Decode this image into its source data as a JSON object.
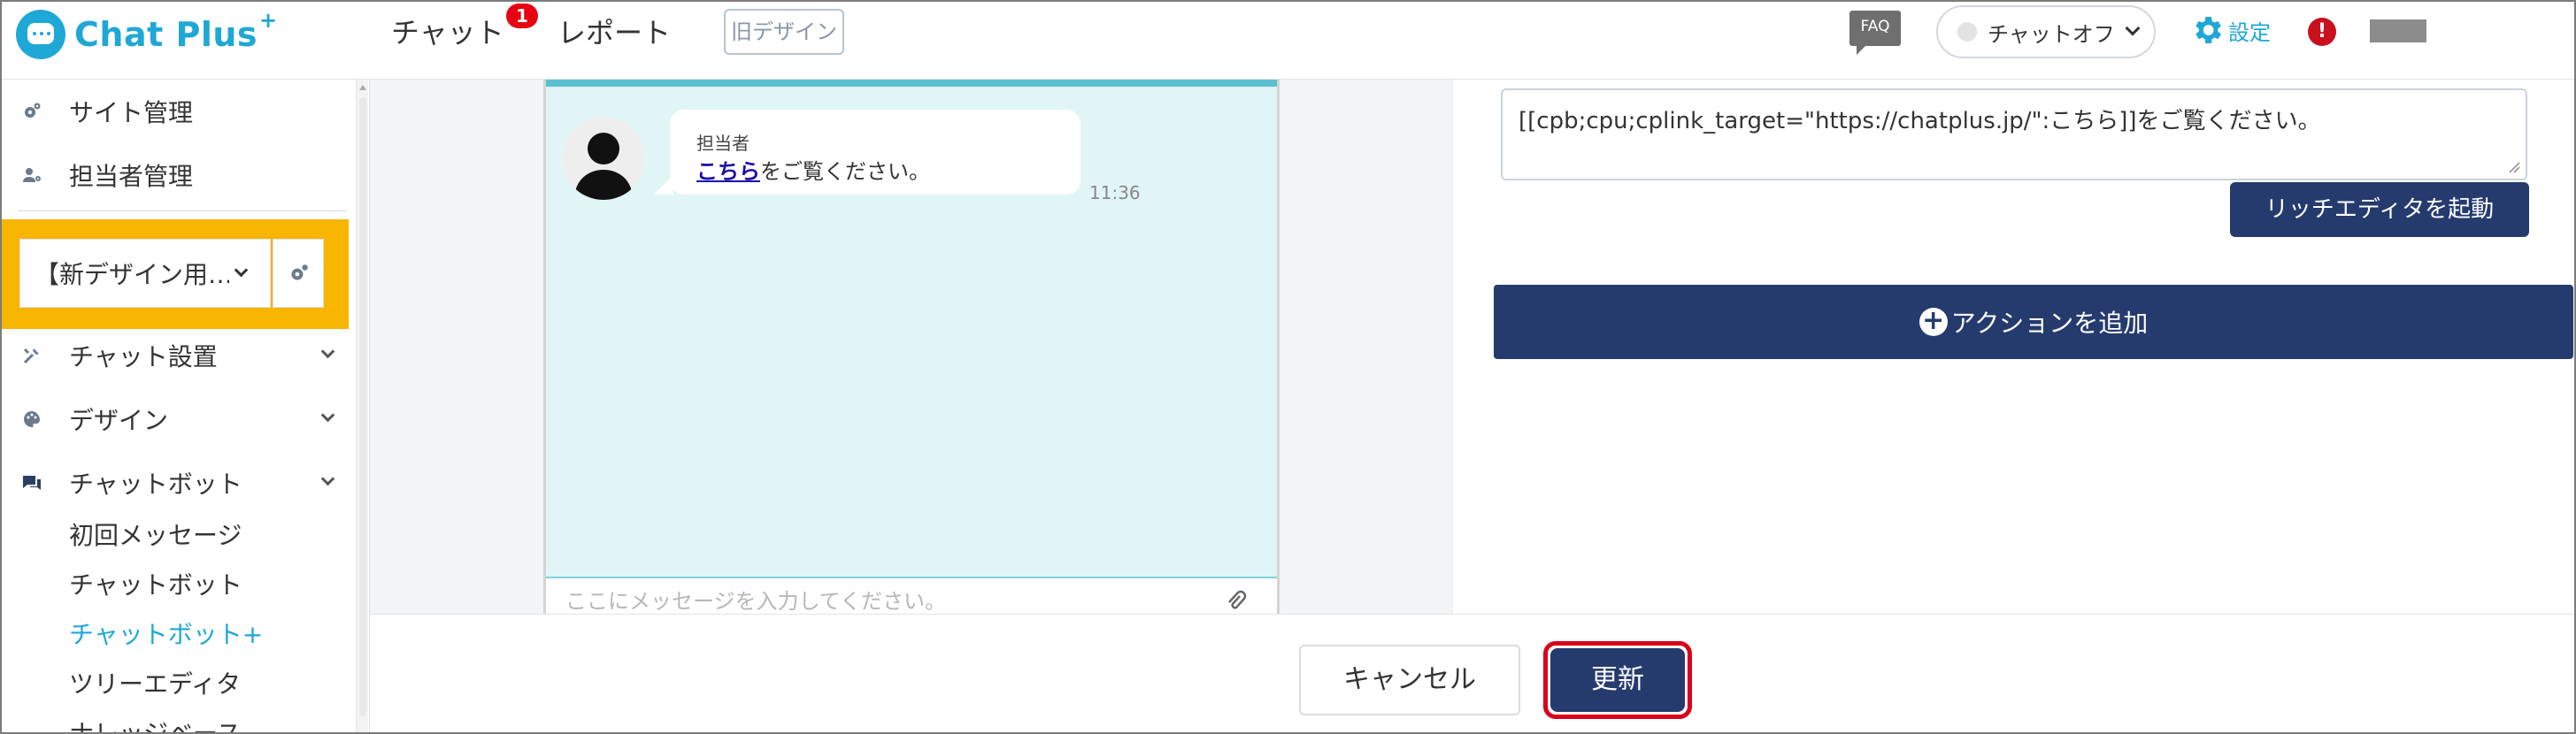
{
  "header": {
    "logo_text": "Chat Plus",
    "logo_plus": "+",
    "nav_chat": "チャット",
    "nav_chat_badge": "1",
    "nav_report": "レポート",
    "nav_old_design": "旧デザイン",
    "faq": "FAQ",
    "status_label": "チャットオフ",
    "settings_label": "設定",
    "alert": "!"
  },
  "sidebar": {
    "items": [
      {
        "label": "サイト管理",
        "icon": "gear-cog-icon"
      },
      {
        "label": "担当者管理",
        "icon": "user-gear-icon"
      }
    ],
    "site_select_label": "【新デザイン用…",
    "menu": [
      {
        "label": "チャット設置",
        "icon": "tools-icon"
      },
      {
        "label": "デザイン",
        "icon": "palette-icon"
      },
      {
        "label": "チャットボット",
        "icon": "chat-bubbles-icon"
      }
    ],
    "submenu": [
      {
        "label": "初回メッセージ"
      },
      {
        "label": "チャットボット"
      },
      {
        "label": "チャットボット+"
      },
      {
        "label": "ツリーエディタ"
      },
      {
        "label": "ナレッジベース"
      }
    ]
  },
  "preview": {
    "sender_name": "担当者",
    "link_text": "こちら",
    "message_rest": "をご覧ください。",
    "time": "11:36",
    "input_placeholder": "ここにメッセージを入力してください。"
  },
  "editor": {
    "message_text": "[[cpb;cpu;cplink_target=\"https://chatplus.jp/\":こちら]]をご覧ください。",
    "rich_editor_button": "リッチエディタを起動",
    "add_action_button": "アクションを追加"
  },
  "footer": {
    "cancel": "キャンセル",
    "update": "更新"
  },
  "colors": {
    "brand": "#1fa8d6",
    "primary_button": "#253b6e",
    "highlight_panel": "#f7b500",
    "badge": "#e60012",
    "focus_ring": "#d9001b"
  }
}
